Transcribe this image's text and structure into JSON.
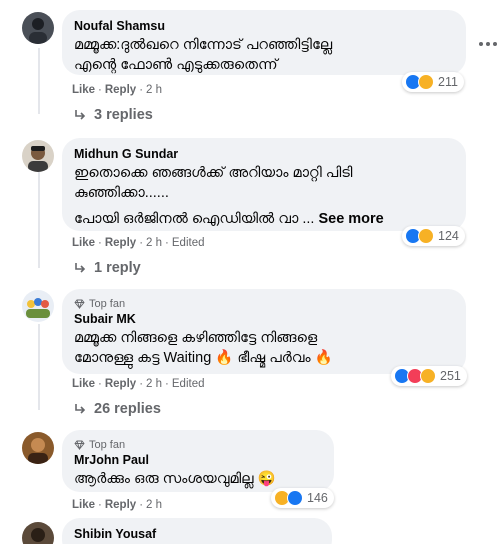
{
  "comments": [
    {
      "author": "Noufal Shamsu",
      "top_fan": "",
      "lines": [
        "മമ്മൂക്ക:ദുൽഖറെ നിന്നോട് പറഞ്ഞിട്ടില്ലേ",
        "എന്റെ ഫോൺ എടുക്കരുതെന്ന്"
      ],
      "like": "Like",
      "reply": "Reply",
      "time": "2 h",
      "edited": "",
      "reaction_count": "211",
      "reaction_icons": [
        "like",
        "haha"
      ],
      "replies_label": "3 replies"
    },
    {
      "author": "Midhun G Sundar",
      "top_fan": "",
      "lines": [
        "ഇതൊക്കെ ഞങ്ങൾക്ക് അറിയാം മാറ്റി പിടി",
        "കുഞ്ഞിക്കാ......",
        "പോയി ഒർജിനൽ ഐഡിയിൽ വാ ..."
      ],
      "see_more": "See more",
      "like": "Like",
      "reply": "Reply",
      "time": "2 h",
      "edited": "Edited",
      "reaction_count": "124",
      "reaction_icons": [
        "like",
        "haha"
      ],
      "replies_label": "1 reply"
    },
    {
      "author": "Subair MK",
      "top_fan": "Top fan",
      "lines": [
        "മമ്മൂക്ക നിങ്ങളെ കഴിഞ്ഞിട്ടേ നിങ്ങളെ",
        "മോനുള്ളു കട്ട Waiting 🔥 ഭീഷ്മ പർവം 🔥"
      ],
      "like": "Like",
      "reply": "Reply",
      "time": "2 h",
      "edited": "Edited",
      "reaction_count": "251",
      "reaction_icons": [
        "like",
        "love",
        "haha"
      ],
      "replies_label": "26 replies"
    },
    {
      "author": "MrJohn Paul",
      "top_fan": "Top fan",
      "lines": [
        "ആർക്കും ഒരു സംശയവുമില്ല 😜"
      ],
      "like": "Like",
      "reply": "Reply",
      "time": "2 h",
      "edited": "",
      "reaction_count": "146",
      "reaction_icons": [
        "haha",
        "like"
      ],
      "replies_label": ""
    },
    {
      "author": "Shibin Yousaf",
      "top_fan": "",
      "lines": []
    }
  ],
  "colors": {
    "like": "#1877f2",
    "love": "#f33e58",
    "haha": "#f7b125",
    "bubble": "#f0f2f5",
    "secondary_text": "#65676b"
  }
}
